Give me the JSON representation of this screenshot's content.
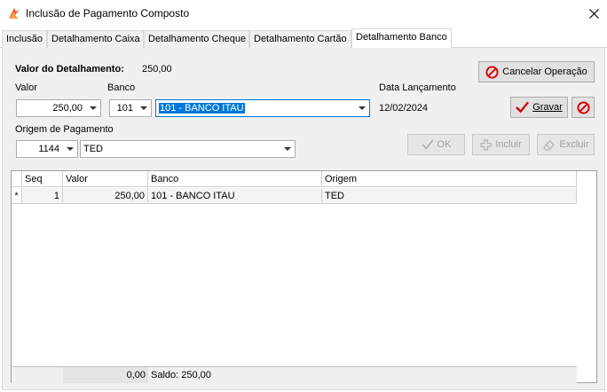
{
  "window": {
    "title": "Inclusão de Pagamento Composto"
  },
  "tabs": [
    {
      "label": "Inclusão"
    },
    {
      "label": "Detalhamento Caixa"
    },
    {
      "label": "Detalhamento Cheque"
    },
    {
      "label": "Detalhamento Cartão"
    },
    {
      "label": "Detalhamento Banco"
    }
  ],
  "active_tab": "Detalhamento Banco",
  "form": {
    "valor_detalhamento_label": "Valor do Detalhamento:",
    "valor_detalhamento": "250,00",
    "valor_label": "Valor",
    "valor": "250,00",
    "banco_label": "Banco",
    "banco_code": "101",
    "banco_name": "101 - BANCO ITAU",
    "data_label": "Data Lançamento",
    "data": "12/02/2024",
    "origem_label": "Origem de Pagamento",
    "origem_code": "1144",
    "origem_name": "TED"
  },
  "buttons": {
    "cancelar": "Cancelar Operação",
    "gravar": "Gravar",
    "ok": "OK",
    "incluir": "Incluir",
    "excluir": "Excluir"
  },
  "grid": {
    "columns": [
      "Seq",
      "Valor",
      "Banco",
      "Origem"
    ],
    "rows": [
      {
        "marker": "*",
        "seq": "1",
        "valor": "250,00",
        "banco": "101 - BANCO ITAU",
        "origem": "TED"
      }
    ],
    "footer": {
      "total": "0,00",
      "saldo": "Saldo: 250,00"
    }
  },
  "colors": {
    "selection": "#0078d7",
    "cancel_icon": "#e00000",
    "check_icon": "#d00000"
  }
}
